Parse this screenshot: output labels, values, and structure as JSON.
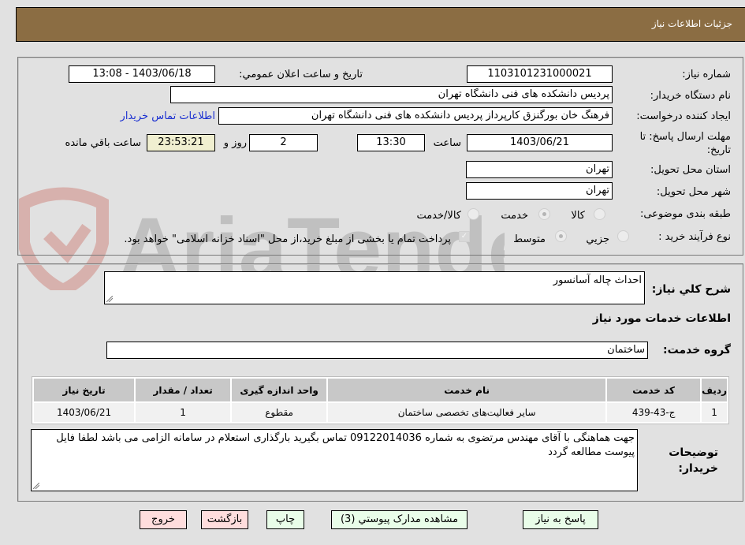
{
  "header": {
    "title": "جزئیات اطلاعات نیاز"
  },
  "form": {
    "need_number": {
      "label": "شماره نیاز:",
      "value": "1103101231000021"
    },
    "announce_datetime": {
      "label": "تاریخ و ساعت اعلان عمومي:",
      "value": "1403/06/18 - 13:08"
    },
    "buyer_org": {
      "label": "نام دستگاه خریدار:",
      "value": "پردیس دانشکده های فنی دانشگاه تهران"
    },
    "requester": {
      "label": "ایجاد کننده درخواست:",
      "value": "فرهنگ خان بورگنزق کارپرداز پردیس دانشکده های فنی دانشگاه تهران"
    },
    "buyer_contact_link": "اطلاعات تماس خریدار",
    "deadline": {
      "label_line1": "مهلت ارسال پاسخ: تا",
      "label_line2": "تاریخ:",
      "date": "1403/06/21",
      "time_label": "ساعت",
      "time": "13:30",
      "days": "2",
      "days_label": "روز و",
      "remaining": "23:53:21",
      "remaining_label": "ساعت باقي مانده"
    },
    "province": {
      "label": "استان محل تحویل:",
      "value": "تهران"
    },
    "city": {
      "label": "شهر محل تحویل:",
      "value": "تهران"
    },
    "category": {
      "label": "طبقه بندی موضوعی:",
      "options": [
        "کالا",
        "خدمت",
        "کالا/خدمت"
      ],
      "selected": "خدمت"
    },
    "purchase_type": {
      "label": "نوع فرآیند خرید :",
      "options": [
        "جزيي",
        "متوسط"
      ],
      "selected": "متوسط",
      "treasury_note": "پرداخت تمام یا بخشی از مبلغ خرید،از محل \"اسناد خزانه اسلامی\" خواهد بود.",
      "treasury_checked": true
    }
  },
  "details": {
    "summary_label": "شرح کلي نیاز:",
    "summary_value": "احداث چاله آسانسور",
    "services_heading": "اطلاعات خدمات مورد نیاز",
    "service_group_label": "گروه خدمت:",
    "service_group_value": "ساختمان",
    "table": {
      "columns": [
        "ردیف",
        "کد خدمت",
        "نام خدمت",
        "واحد اندازه گیری",
        "تعداد / مقدار",
        "تاریخ نیاز"
      ],
      "rows": [
        [
          "1",
          "ج-43-439",
          "سایر فعالیت‌های تخصصی ساختمان",
          "مقطوع",
          "1",
          "1403/06/21"
        ]
      ]
    },
    "buyer_notes_label_line1": "توضیحات",
    "buyer_notes_label_line2": "خریدار:",
    "buyer_notes_value": "جهت هماهنگی با آقای مهندس مرتضوی به شماره 09122014036 تماس بگیرید بارگذاری استعلام در سامانه الزامی می باشد لطفا فایل پیوست مطالعه گردد"
  },
  "buttons": {
    "reply": "پاسخ به نیاز",
    "attachments": "مشاهده مدارک پیوستي (3)",
    "print": "چاپ",
    "back": "بازگشت",
    "exit": "خروج"
  },
  "watermark": {
    "text": "AriaTender.neT"
  },
  "colors": {
    "header_bg": "#8b6d43",
    "link": "#1a2fd1",
    "btn_green": "#e9fde9",
    "btn_pink": "#ffdddd",
    "remaining_bg": "#f0efd0"
  }
}
